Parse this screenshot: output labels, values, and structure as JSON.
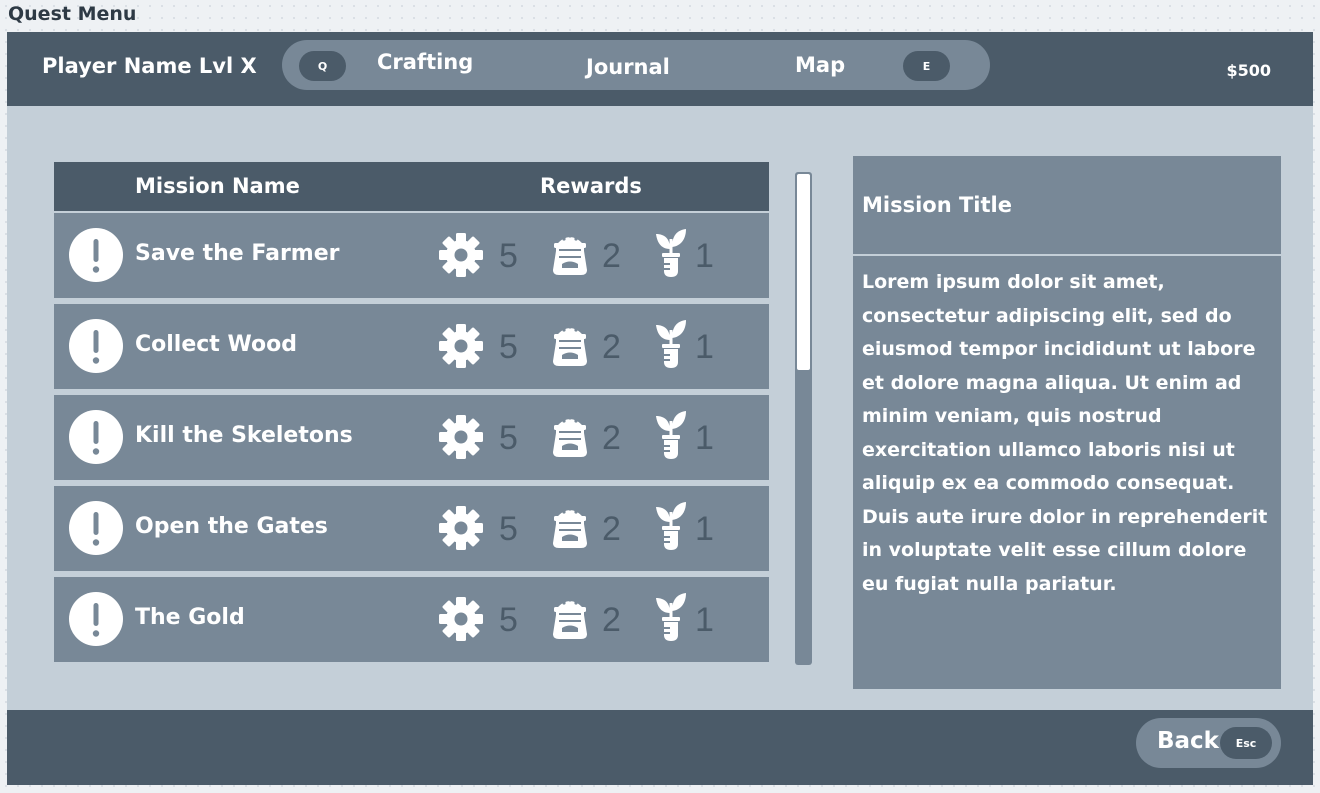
{
  "page_title": "Quest Menu",
  "topbar": {
    "player_name": "Player Name Lvl X",
    "tabs": [
      {
        "label": "Crafting"
      },
      {
        "label": "Journal"
      },
      {
        "label": "Map"
      }
    ],
    "prev_key": "Q",
    "next_key": "E",
    "money": "$500"
  },
  "mission_table": {
    "headers": {
      "name": "Mission Name",
      "rewards": "Rewards"
    },
    "reward_icons": [
      "gear-icon",
      "sack-icon",
      "sprout-icon"
    ],
    "missions": [
      {
        "name": "Save the Farmer",
        "rewards": [
          "5",
          "2",
          "1"
        ]
      },
      {
        "name": "Collect Wood",
        "rewards": [
          "5",
          "2",
          "1"
        ]
      },
      {
        "name": "Kill the Skeletons",
        "rewards": [
          "5",
          "2",
          "1"
        ]
      },
      {
        "name": "Open the Gates",
        "rewards": [
          "5",
          "2",
          "1"
        ]
      },
      {
        "name": "The Gold",
        "rewards": [
          "5",
          "2",
          "1"
        ]
      }
    ]
  },
  "detail": {
    "title": "Mission Title",
    "body": "Lorem ipsum dolor sit amet, consectetur adipiscing elit, sed do eiusmod tempor incididunt ut labore et dolore magna aliqua. Ut enim ad minim veniam, quis nostrud exercitation ullamco laboris nisi ut aliquip ex ea commodo consequat. Duis aute irure dolor in reprehenderit in voluptate velit esse cillum dolore eu fugiat nulla pariatur."
  },
  "footer": {
    "back_label": "Back",
    "back_key": "Esc"
  },
  "colors": {
    "dark_panel": "#4b5b69",
    "mid_panel": "#788897",
    "background": "#c4cfd8",
    "text": "#ffffff"
  }
}
